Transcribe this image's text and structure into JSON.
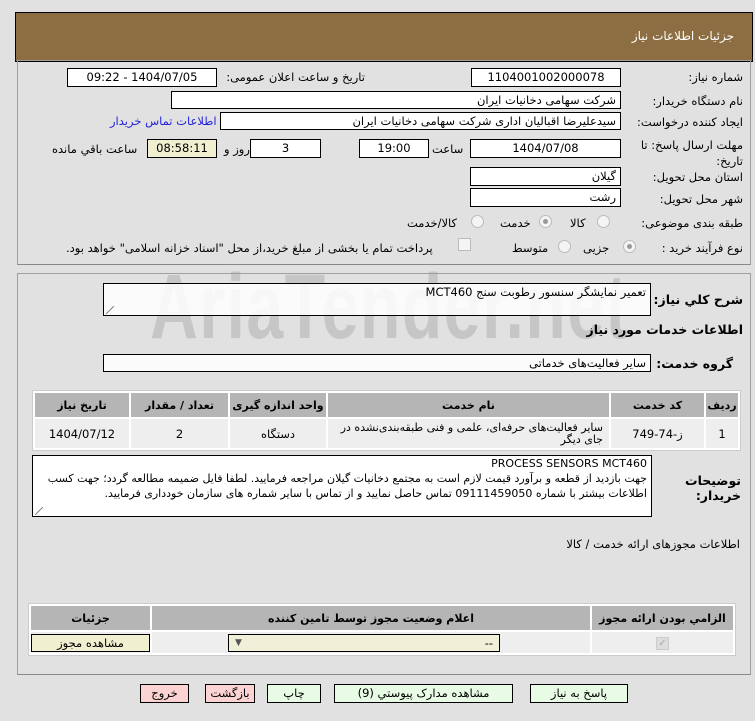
{
  "header": {
    "title": "جزئیات اطلاعات نیاز"
  },
  "form": {
    "need_number_label": "شماره نیاز:",
    "need_number": "1104001002000078",
    "announce_label": "تاریخ و ساعت اعلان عمومی:",
    "announce_value": "1404/07/05 - 09:22",
    "buyer_label": "نام دستگاه خریدار:",
    "buyer": "شرکت سهامی دخانیات ایران",
    "creator_label": "ایجاد کننده درخواست:",
    "creator": "سیدعلیرضا اقبالیان اداری شرکت سهامی دخانیات ایران",
    "contact_link": "اطلاعات تماس خریدار",
    "deadline_label": "مهلت ارسال پاسخ: تا",
    "deadline_label2": "تاریخ:",
    "deadline_date": "1404/07/08",
    "time_label": "ساعت",
    "deadline_time": "19:00",
    "days": "3",
    "days_label": "روز و",
    "remaining": "08:58:11",
    "remaining_label": "ساعت باقي مانده",
    "province_label": "استان محل تحویل:",
    "province": "گیلان",
    "city_label": "شهر محل تحویل:",
    "city": "رشت",
    "category_label": "طبقه بندی موضوعی:",
    "category_options": [
      "کالا",
      "خدمت",
      "کالا/خدمت"
    ],
    "category_selected": "خدمت",
    "process_label": "نوع فرآیند خرید :",
    "process_options": [
      "جزیی",
      "متوسط"
    ],
    "process_selected": "جزیی",
    "payment_note": "پرداخت تمام یا بخشی از مبلغ خرید،از محل \"اسناد خزانه اسلامی\" خواهد بود."
  },
  "watermark": "AriaTender.net",
  "details": {
    "summary_label": "شرح کلي نیاز:",
    "summary": "تعمیر نمایشگر سنسور رطوبت سنج  MCT460",
    "services_title": "اطلاعات خدمات مورد نیاز",
    "group_label": "گروه خدمت:",
    "group": "سایر فعالیت‌های خدماتی",
    "table": {
      "headers": [
        "ردیف",
        "کد خدمت",
        "نام خدمت",
        "واحد اندازه گیری",
        "تعداد / مقدار",
        "تاریخ نیاز"
      ],
      "rows": [
        [
          "1",
          "ز-74-749",
          "سایر فعالیت‌های حرفه‌ای، علمی و فنی طبقه‌بندی‌نشده در جای دیگر",
          "دستگاه",
          "2",
          "1404/07/12"
        ]
      ]
    },
    "desc_label": "توضیحات خریدار:",
    "desc_line1": "PROCESS SENSORS MCT460",
    "desc_line2": "جهت بازدید از قطعه و برآورد قیمت لازم است به مجتمع دخانیات گیلان مراجعه فرمایید. لطفا فایل ضمیمه مطالعه گردد؛ جهت کسب اطلاعات بیشتر با شماره 09111459050 تماس حاصل نمایید و از تماس با سایر شماره های سازمان خودداری فرمایید."
  },
  "permits": {
    "title": "اطلاعات مجوزهای ارائه خدمت / کالا",
    "headers": [
      "الزامي بودن ارائه مجوز",
      "اعلام وضعیت مجوز توسط تامین کننده",
      "جزئیات"
    ],
    "select_value": "--",
    "view_button": "مشاهده مجوز"
  },
  "buttons": {
    "reply": "پاسخ به نیاز",
    "attachments": "مشاهده مدارک پیوستي (9)",
    "print": "چاپ",
    "back": "بازگشت",
    "exit": "خروج"
  }
}
